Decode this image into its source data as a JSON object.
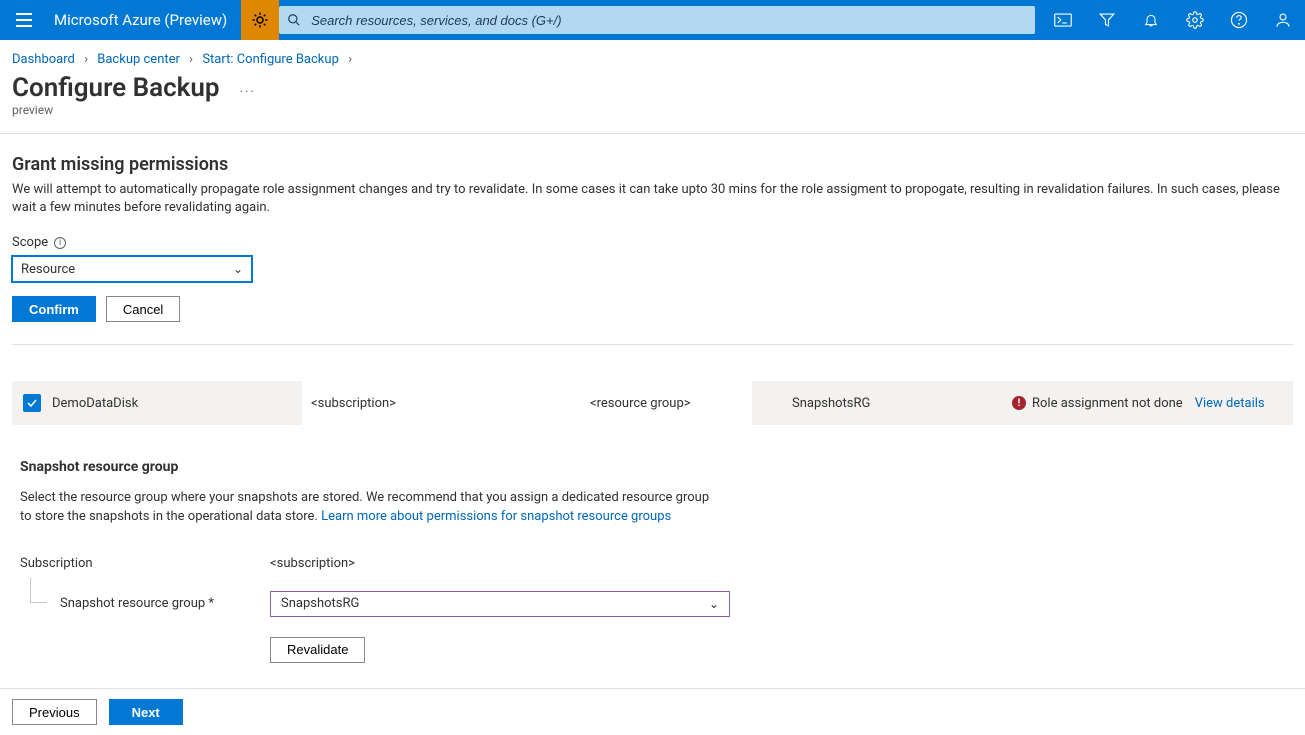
{
  "header": {
    "brand": "Microsoft Azure (Preview)",
    "search_placeholder": "Search resources, services, and docs (G+/)",
    "icons": {
      "menu": "menu-icon",
      "sun": "sun-icon",
      "cloudshell": "cloud-shell-icon",
      "filter": "filter-icon",
      "bell": "notifications-icon",
      "gear": "settings-icon",
      "help": "help-icon",
      "account": "account-icon"
    }
  },
  "breadcrumb": {
    "items": [
      "Dashboard",
      "Backup center",
      "Start: Configure Backup"
    ]
  },
  "page": {
    "title": "Configure Backup",
    "subtitle": "preview",
    "more": "..."
  },
  "permissions": {
    "heading": "Grant missing permissions",
    "description": "We will attempt to automatically propagate role assignment changes and try to revalidate. In some cases it can take upto 30 mins for the role assigment to propogate, resulting in revalidation failures. In such cases, please wait a few minutes before revalidating again.",
    "scope_label": "Scope",
    "scope_value": "Resource",
    "confirm": "Confirm",
    "cancel": "Cancel"
  },
  "table": {
    "row": {
      "name": "DemoDataDisk",
      "subscription": "<subscription>",
      "resource_group": "<resource group>",
      "snapshot_rg": "SnapshotsRG",
      "status": "Role assignment not done",
      "view_details": "View details"
    }
  },
  "snapshot": {
    "heading": "Snapshot resource group",
    "description": "Select the resource group where your snapshots are stored. We recommend that you assign a dedicated resource group to store the snapshots in the operational data store. ",
    "learn_more": "Learn more about permissions for snapshot resource groups",
    "subscription_label": "Subscription",
    "subscription_value": "<subscription>",
    "rg_label": "Snapshot resource group *",
    "rg_value": "SnapshotsRG",
    "revalidate": "Revalidate"
  },
  "footer": {
    "previous": "Previous",
    "next": "Next"
  }
}
